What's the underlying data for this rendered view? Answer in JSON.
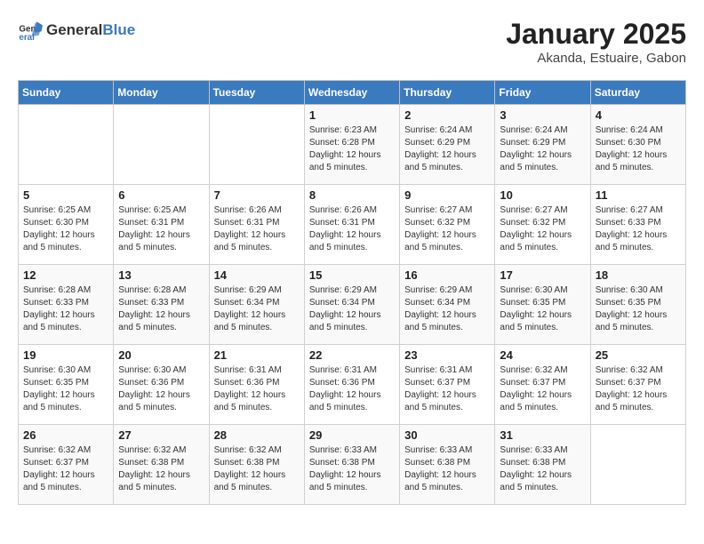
{
  "logo": {
    "general": "General",
    "blue": "Blue"
  },
  "title": "January 2025",
  "subtitle": "Akanda, Estuaire, Gabon",
  "days_of_week": [
    "Sunday",
    "Monday",
    "Tuesday",
    "Wednesday",
    "Thursday",
    "Friday",
    "Saturday"
  ],
  "weeks": [
    [
      {
        "day": "",
        "info": ""
      },
      {
        "day": "",
        "info": ""
      },
      {
        "day": "",
        "info": ""
      },
      {
        "day": "1",
        "info": "Sunrise: 6:23 AM\nSunset: 6:28 PM\nDaylight: 12 hours and 5 minutes."
      },
      {
        "day": "2",
        "info": "Sunrise: 6:24 AM\nSunset: 6:29 PM\nDaylight: 12 hours and 5 minutes."
      },
      {
        "day": "3",
        "info": "Sunrise: 6:24 AM\nSunset: 6:29 PM\nDaylight: 12 hours and 5 minutes."
      },
      {
        "day": "4",
        "info": "Sunrise: 6:24 AM\nSunset: 6:30 PM\nDaylight: 12 hours and 5 minutes."
      }
    ],
    [
      {
        "day": "5",
        "info": "Sunrise: 6:25 AM\nSunset: 6:30 PM\nDaylight: 12 hours and 5 minutes."
      },
      {
        "day": "6",
        "info": "Sunrise: 6:25 AM\nSunset: 6:31 PM\nDaylight: 12 hours and 5 minutes."
      },
      {
        "day": "7",
        "info": "Sunrise: 6:26 AM\nSunset: 6:31 PM\nDaylight: 12 hours and 5 minutes."
      },
      {
        "day": "8",
        "info": "Sunrise: 6:26 AM\nSunset: 6:31 PM\nDaylight: 12 hours and 5 minutes."
      },
      {
        "day": "9",
        "info": "Sunrise: 6:27 AM\nSunset: 6:32 PM\nDaylight: 12 hours and 5 minutes."
      },
      {
        "day": "10",
        "info": "Sunrise: 6:27 AM\nSunset: 6:32 PM\nDaylight: 12 hours and 5 minutes."
      },
      {
        "day": "11",
        "info": "Sunrise: 6:27 AM\nSunset: 6:33 PM\nDaylight: 12 hours and 5 minutes."
      }
    ],
    [
      {
        "day": "12",
        "info": "Sunrise: 6:28 AM\nSunset: 6:33 PM\nDaylight: 12 hours and 5 minutes."
      },
      {
        "day": "13",
        "info": "Sunrise: 6:28 AM\nSunset: 6:33 PM\nDaylight: 12 hours and 5 minutes."
      },
      {
        "day": "14",
        "info": "Sunrise: 6:29 AM\nSunset: 6:34 PM\nDaylight: 12 hours and 5 minutes."
      },
      {
        "day": "15",
        "info": "Sunrise: 6:29 AM\nSunset: 6:34 PM\nDaylight: 12 hours and 5 minutes."
      },
      {
        "day": "16",
        "info": "Sunrise: 6:29 AM\nSunset: 6:34 PM\nDaylight: 12 hours and 5 minutes."
      },
      {
        "day": "17",
        "info": "Sunrise: 6:30 AM\nSunset: 6:35 PM\nDaylight: 12 hours and 5 minutes."
      },
      {
        "day": "18",
        "info": "Sunrise: 6:30 AM\nSunset: 6:35 PM\nDaylight: 12 hours and 5 minutes."
      }
    ],
    [
      {
        "day": "19",
        "info": "Sunrise: 6:30 AM\nSunset: 6:35 PM\nDaylight: 12 hours and 5 minutes."
      },
      {
        "day": "20",
        "info": "Sunrise: 6:30 AM\nSunset: 6:36 PM\nDaylight: 12 hours and 5 minutes."
      },
      {
        "day": "21",
        "info": "Sunrise: 6:31 AM\nSunset: 6:36 PM\nDaylight: 12 hours and 5 minutes."
      },
      {
        "day": "22",
        "info": "Sunrise: 6:31 AM\nSunset: 6:36 PM\nDaylight: 12 hours and 5 minutes."
      },
      {
        "day": "23",
        "info": "Sunrise: 6:31 AM\nSunset: 6:37 PM\nDaylight: 12 hours and 5 minutes."
      },
      {
        "day": "24",
        "info": "Sunrise: 6:32 AM\nSunset: 6:37 PM\nDaylight: 12 hours and 5 minutes."
      },
      {
        "day": "25",
        "info": "Sunrise: 6:32 AM\nSunset: 6:37 PM\nDaylight: 12 hours and 5 minutes."
      }
    ],
    [
      {
        "day": "26",
        "info": "Sunrise: 6:32 AM\nSunset: 6:37 PM\nDaylight: 12 hours and 5 minutes."
      },
      {
        "day": "27",
        "info": "Sunrise: 6:32 AM\nSunset: 6:38 PM\nDaylight: 12 hours and 5 minutes."
      },
      {
        "day": "28",
        "info": "Sunrise: 6:32 AM\nSunset: 6:38 PM\nDaylight: 12 hours and 5 minutes."
      },
      {
        "day": "29",
        "info": "Sunrise: 6:33 AM\nSunset: 6:38 PM\nDaylight: 12 hours and 5 minutes."
      },
      {
        "day": "30",
        "info": "Sunrise: 6:33 AM\nSunset: 6:38 PM\nDaylight: 12 hours and 5 minutes."
      },
      {
        "day": "31",
        "info": "Sunrise: 6:33 AM\nSunset: 6:38 PM\nDaylight: 12 hours and 5 minutes."
      },
      {
        "day": "",
        "info": ""
      }
    ]
  ]
}
